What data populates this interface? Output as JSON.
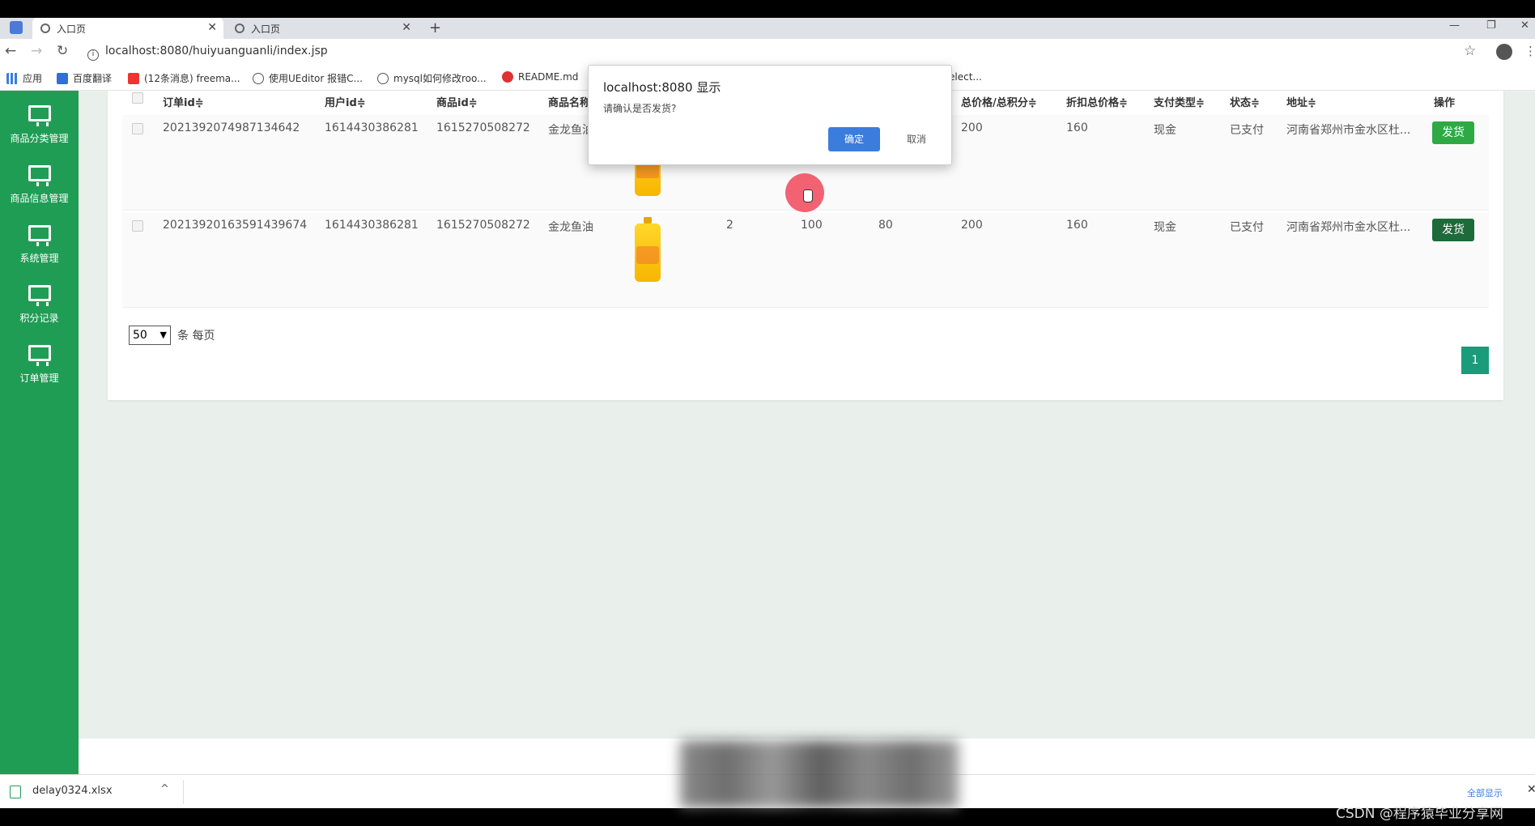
{
  "browser": {
    "tabs": [
      {
        "title": "入口页",
        "active": true
      },
      {
        "title": "入口页",
        "active": false
      }
    ],
    "new_tab": "+",
    "url": "localhost:8080/huiyuanguanli/index.jsp",
    "bookmarks": [
      {
        "label": "应用",
        "icon": "apps-grid-icon"
      },
      {
        "label": "百度翻译",
        "icon": "translate-icon"
      },
      {
        "label": "(12条消息) freema...",
        "icon": "csdn-icon"
      },
      {
        "label": "使用UEditor 报错C...",
        "icon": "search-bookmark-icon"
      },
      {
        "label": "mysql如何修改roo...",
        "icon": "search-bookmark-icon"
      },
      {
        "label": "README.md",
        "icon": "github-icon"
      },
      {
        "label": "elect...",
        "icon": ""
      }
    ]
  },
  "sidebar": {
    "items": [
      {
        "label": "商品分类管理"
      },
      {
        "label": "商品信息管理"
      },
      {
        "label": "系统管理"
      },
      {
        "label": "积分记录"
      },
      {
        "label": "订单管理"
      }
    ]
  },
  "table": {
    "headers": [
      "订单id≑",
      "用户id≑",
      "商品id≑",
      "商品名称",
      "总价格/总积分≑",
      "折扣总价格≑",
      "支付类型≑",
      "状态≑",
      "地址≑",
      "操作"
    ],
    "rows": [
      {
        "order_id": "2021392074987134642",
        "user_id": "1614430386281",
        "goods_id": "1615270508272",
        "goods_name": "金龙鱼油",
        "qty": "",
        "price": "",
        "points": "",
        "total": "200",
        "discount_total": "160",
        "pay_type": "现金",
        "status": "已支付",
        "address": "河南省郑州市金水区杜...",
        "action": "发货"
      },
      {
        "order_id": "2021392016359143967​4",
        "user_id": "1614430386281",
        "goods_id": "1615270508272",
        "goods_name": "金龙鱼油",
        "qty": "2",
        "price": "100",
        "points": "80",
        "total": "200",
        "discount_total": "160",
        "pay_type": "现金",
        "status": "已支付",
        "address": "河南省郑州市金水区杜...",
        "action": "发货"
      }
    ]
  },
  "pager": {
    "page_size": "50",
    "per_page_label": "条 每页",
    "current_page": "1"
  },
  "dialog": {
    "title": "localhost:8080 显示",
    "message": "请确认是否发货?",
    "ok_label": "确定",
    "cancel_label": "取消"
  },
  "download": {
    "file": "delay0324.xlsx",
    "show_all": "全部显示"
  },
  "watermark": "CSDN @程序猿毕业分享网",
  "colors": {
    "sidebar": "#1f9d55",
    "ship_button": "#2eaa44",
    "ship_button_dark": "#1d6a3b",
    "ok_button": "#3b7ddd",
    "page_button": "#1a9c7a"
  }
}
